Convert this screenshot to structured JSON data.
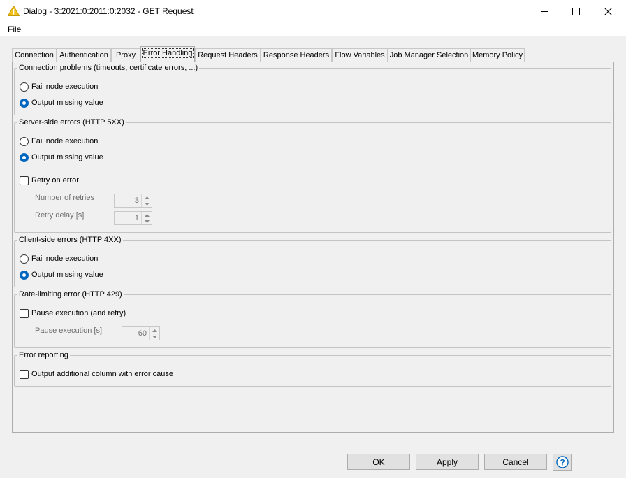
{
  "window": {
    "title": "Dialog - 3:2021:0:2011:0:2032 - GET Request",
    "controls": {
      "minimize_icon": "minimize-icon",
      "maximize_icon": "maximize-icon",
      "close_icon": "close-icon"
    }
  },
  "menu": {
    "file": "File"
  },
  "tabs": [
    {
      "label": "Connection",
      "active": false
    },
    {
      "label": "Authentication",
      "active": false
    },
    {
      "label": "Proxy",
      "active": false
    },
    {
      "label": "Error Handling",
      "active": true
    },
    {
      "label": "Request Headers",
      "active": false
    },
    {
      "label": "Response Headers",
      "active": false
    },
    {
      "label": "Flow Variables",
      "active": false
    },
    {
      "label": "Job Manager Selection",
      "active": false
    },
    {
      "label": "Memory Policy",
      "active": false
    }
  ],
  "groups": {
    "connection": {
      "title": "Connection problems (timeouts, certificate errors, ...)",
      "fail": "Fail node execution",
      "missing": "Output missing value",
      "selected": "missing"
    },
    "server": {
      "title": "Server-side errors (HTTP 5XX)",
      "fail": "Fail node execution",
      "missing": "Output missing value",
      "selected": "missing",
      "retry_label": "Retry on error",
      "retry_checked": false,
      "retries_label": "Number of retries",
      "retries_value": "3",
      "delay_label": "Retry delay [s]",
      "delay_value": "1"
    },
    "client": {
      "title": "Client-side errors (HTTP 4XX)",
      "fail": "Fail node execution",
      "missing": "Output missing value",
      "selected": "missing"
    },
    "rate": {
      "title": "Rate-limiting error (HTTP 429)",
      "pause_label": "Pause execution (and retry)",
      "pause_checked": false,
      "pause_field_label": "Pause execution [s]",
      "pause_value": "60"
    },
    "reporting": {
      "title": "Error reporting",
      "column_label": "Output additional column with error cause",
      "column_checked": false
    }
  },
  "buttons": {
    "ok": "OK",
    "apply": "Apply",
    "cancel": "Cancel",
    "help_icon": "help-icon"
  },
  "colors": {
    "accent": "#0067c0",
    "warning_icon": "#f2c21b"
  }
}
